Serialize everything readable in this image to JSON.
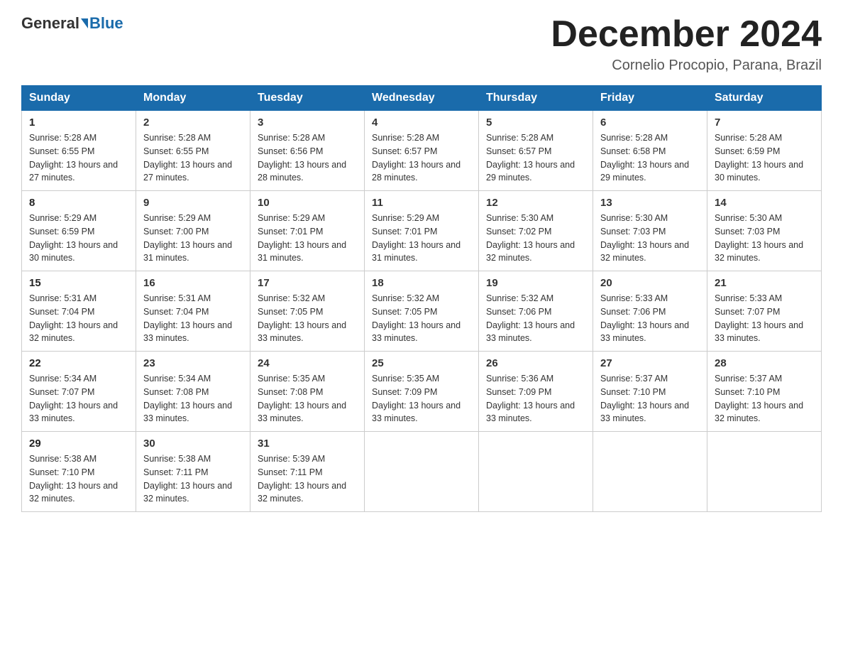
{
  "header": {
    "logo_general": "General",
    "logo_blue": "Blue",
    "title": "December 2024",
    "subtitle": "Cornelio Procopio, Parana, Brazil"
  },
  "columns": [
    "Sunday",
    "Monday",
    "Tuesday",
    "Wednesday",
    "Thursday",
    "Friday",
    "Saturday"
  ],
  "weeks": [
    [
      {
        "day": "1",
        "sunrise": "Sunrise: 5:28 AM",
        "sunset": "Sunset: 6:55 PM",
        "daylight": "Daylight: 13 hours and 27 minutes."
      },
      {
        "day": "2",
        "sunrise": "Sunrise: 5:28 AM",
        "sunset": "Sunset: 6:55 PM",
        "daylight": "Daylight: 13 hours and 27 minutes."
      },
      {
        "day": "3",
        "sunrise": "Sunrise: 5:28 AM",
        "sunset": "Sunset: 6:56 PM",
        "daylight": "Daylight: 13 hours and 28 minutes."
      },
      {
        "day": "4",
        "sunrise": "Sunrise: 5:28 AM",
        "sunset": "Sunset: 6:57 PM",
        "daylight": "Daylight: 13 hours and 28 minutes."
      },
      {
        "day": "5",
        "sunrise": "Sunrise: 5:28 AM",
        "sunset": "Sunset: 6:57 PM",
        "daylight": "Daylight: 13 hours and 29 minutes."
      },
      {
        "day": "6",
        "sunrise": "Sunrise: 5:28 AM",
        "sunset": "Sunset: 6:58 PM",
        "daylight": "Daylight: 13 hours and 29 minutes."
      },
      {
        "day": "7",
        "sunrise": "Sunrise: 5:28 AM",
        "sunset": "Sunset: 6:59 PM",
        "daylight": "Daylight: 13 hours and 30 minutes."
      }
    ],
    [
      {
        "day": "8",
        "sunrise": "Sunrise: 5:29 AM",
        "sunset": "Sunset: 6:59 PM",
        "daylight": "Daylight: 13 hours and 30 minutes."
      },
      {
        "day": "9",
        "sunrise": "Sunrise: 5:29 AM",
        "sunset": "Sunset: 7:00 PM",
        "daylight": "Daylight: 13 hours and 31 minutes."
      },
      {
        "day": "10",
        "sunrise": "Sunrise: 5:29 AM",
        "sunset": "Sunset: 7:01 PM",
        "daylight": "Daylight: 13 hours and 31 minutes."
      },
      {
        "day": "11",
        "sunrise": "Sunrise: 5:29 AM",
        "sunset": "Sunset: 7:01 PM",
        "daylight": "Daylight: 13 hours and 31 minutes."
      },
      {
        "day": "12",
        "sunrise": "Sunrise: 5:30 AM",
        "sunset": "Sunset: 7:02 PM",
        "daylight": "Daylight: 13 hours and 32 minutes."
      },
      {
        "day": "13",
        "sunrise": "Sunrise: 5:30 AM",
        "sunset": "Sunset: 7:03 PM",
        "daylight": "Daylight: 13 hours and 32 minutes."
      },
      {
        "day": "14",
        "sunrise": "Sunrise: 5:30 AM",
        "sunset": "Sunset: 7:03 PM",
        "daylight": "Daylight: 13 hours and 32 minutes."
      }
    ],
    [
      {
        "day": "15",
        "sunrise": "Sunrise: 5:31 AM",
        "sunset": "Sunset: 7:04 PM",
        "daylight": "Daylight: 13 hours and 32 minutes."
      },
      {
        "day": "16",
        "sunrise": "Sunrise: 5:31 AM",
        "sunset": "Sunset: 7:04 PM",
        "daylight": "Daylight: 13 hours and 33 minutes."
      },
      {
        "day": "17",
        "sunrise": "Sunrise: 5:32 AM",
        "sunset": "Sunset: 7:05 PM",
        "daylight": "Daylight: 13 hours and 33 minutes."
      },
      {
        "day": "18",
        "sunrise": "Sunrise: 5:32 AM",
        "sunset": "Sunset: 7:05 PM",
        "daylight": "Daylight: 13 hours and 33 minutes."
      },
      {
        "day": "19",
        "sunrise": "Sunrise: 5:32 AM",
        "sunset": "Sunset: 7:06 PM",
        "daylight": "Daylight: 13 hours and 33 minutes."
      },
      {
        "day": "20",
        "sunrise": "Sunrise: 5:33 AM",
        "sunset": "Sunset: 7:06 PM",
        "daylight": "Daylight: 13 hours and 33 minutes."
      },
      {
        "day": "21",
        "sunrise": "Sunrise: 5:33 AM",
        "sunset": "Sunset: 7:07 PM",
        "daylight": "Daylight: 13 hours and 33 minutes."
      }
    ],
    [
      {
        "day": "22",
        "sunrise": "Sunrise: 5:34 AM",
        "sunset": "Sunset: 7:07 PM",
        "daylight": "Daylight: 13 hours and 33 minutes."
      },
      {
        "day": "23",
        "sunrise": "Sunrise: 5:34 AM",
        "sunset": "Sunset: 7:08 PM",
        "daylight": "Daylight: 13 hours and 33 minutes."
      },
      {
        "day": "24",
        "sunrise": "Sunrise: 5:35 AM",
        "sunset": "Sunset: 7:08 PM",
        "daylight": "Daylight: 13 hours and 33 minutes."
      },
      {
        "day": "25",
        "sunrise": "Sunrise: 5:35 AM",
        "sunset": "Sunset: 7:09 PM",
        "daylight": "Daylight: 13 hours and 33 minutes."
      },
      {
        "day": "26",
        "sunrise": "Sunrise: 5:36 AM",
        "sunset": "Sunset: 7:09 PM",
        "daylight": "Daylight: 13 hours and 33 minutes."
      },
      {
        "day": "27",
        "sunrise": "Sunrise: 5:37 AM",
        "sunset": "Sunset: 7:10 PM",
        "daylight": "Daylight: 13 hours and 33 minutes."
      },
      {
        "day": "28",
        "sunrise": "Sunrise: 5:37 AM",
        "sunset": "Sunset: 7:10 PM",
        "daylight": "Daylight: 13 hours and 32 minutes."
      }
    ],
    [
      {
        "day": "29",
        "sunrise": "Sunrise: 5:38 AM",
        "sunset": "Sunset: 7:10 PM",
        "daylight": "Daylight: 13 hours and 32 minutes."
      },
      {
        "day": "30",
        "sunrise": "Sunrise: 5:38 AM",
        "sunset": "Sunset: 7:11 PM",
        "daylight": "Daylight: 13 hours and 32 minutes."
      },
      {
        "day": "31",
        "sunrise": "Sunrise: 5:39 AM",
        "sunset": "Sunset: 7:11 PM",
        "daylight": "Daylight: 13 hours and 32 minutes."
      },
      null,
      null,
      null,
      null
    ]
  ]
}
